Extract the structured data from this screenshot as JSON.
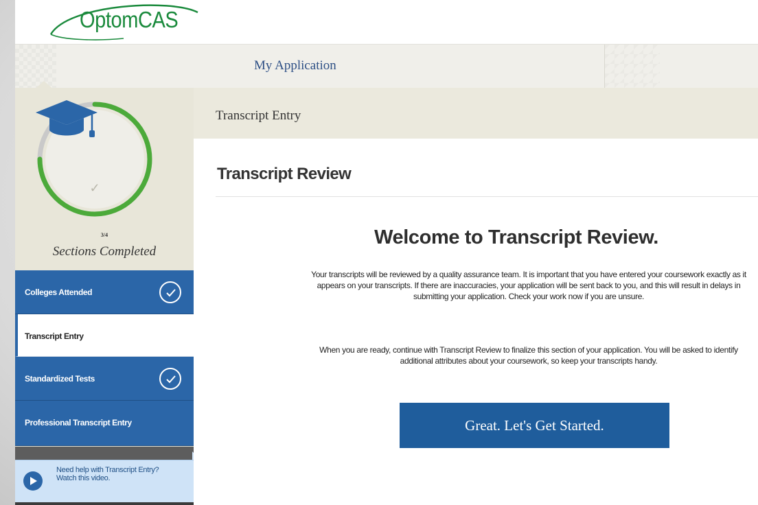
{
  "brand": {
    "name": "OptomCAS",
    "color": "#1a8a3c"
  },
  "nav": {
    "tabs": [
      {
        "label": "My Application"
      }
    ]
  },
  "progress": {
    "completed": 3,
    "total": 4,
    "count_label": "3/4",
    "label": "Sections Completed",
    "ring_color": "#4caa3a"
  },
  "sections": [
    {
      "label": "Colleges Attended",
      "completed": true,
      "active": false
    },
    {
      "label": "Transcript Entry",
      "completed": false,
      "active": true
    },
    {
      "label": "Standardized Tests",
      "completed": true,
      "active": false
    },
    {
      "label": "Professional Transcript Entry",
      "completed": false,
      "active": false
    }
  ],
  "help": {
    "line1": "Need help with Transcript Entry?",
    "link": "Watch this video."
  },
  "breadcrumb": "Transcript Entry",
  "main": {
    "title": "Transcript Review",
    "welcome": "Welcome to Transcript Review.",
    "paragraph1": "Your transcripts will be reviewed by a quality assurance team. It is important that you have entered your coursework exactly as it appears on your transcripts. If there are inaccuracies, your application will be sent back to you, and this will result in delays in submitting your application. Check your work now if you are unsure.",
    "paragraph2": "When you are ready, continue with Transcript Review to finalize this section of your application. You will be asked to identify additional attributes about your coursework, so keep your transcripts handy.",
    "cta_label": "Great. Let's Get Started."
  },
  "colors": {
    "primary": "#2b66a8",
    "button": "#1f5d9c",
    "sidebar_bg": "#e8e6d9"
  },
  "icons": {
    "progress": "graduation-cap-icon",
    "help": "play-icon",
    "done": "check-circle-icon"
  }
}
